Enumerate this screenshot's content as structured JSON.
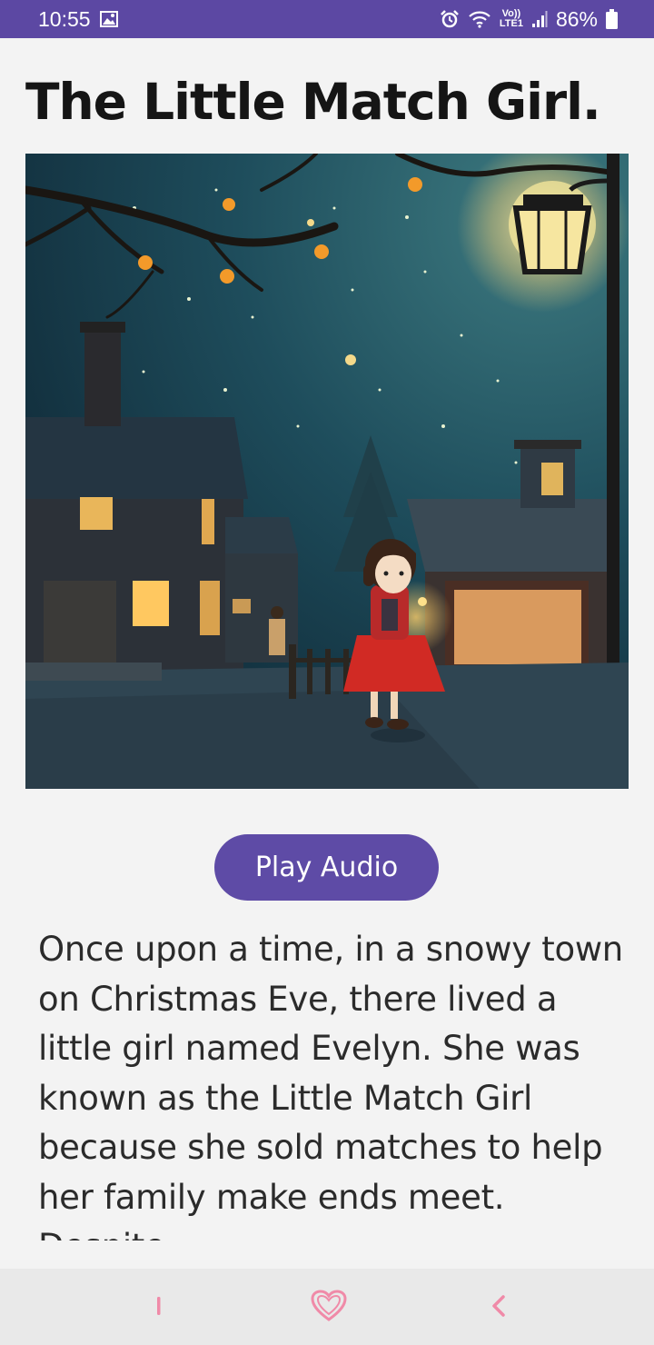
{
  "status_bar": {
    "time": "10:55",
    "network_top": "Vo))",
    "network_bottom": "LTE1",
    "battery": "86%"
  },
  "page": {
    "title": "The Little Match Girl.",
    "play_button_label": "Play Audio",
    "story_text": "Once upon a time, in a snowy town on Christmas Eve, there lived a little girl named Evelyn. She was known as the Little Match Girl because she sold matches to help her family make ends meet. Despite"
  },
  "colors": {
    "status_bar": "#5c48a3",
    "accent": "#5e4ba6",
    "nav_icons": "#f08aa8"
  }
}
